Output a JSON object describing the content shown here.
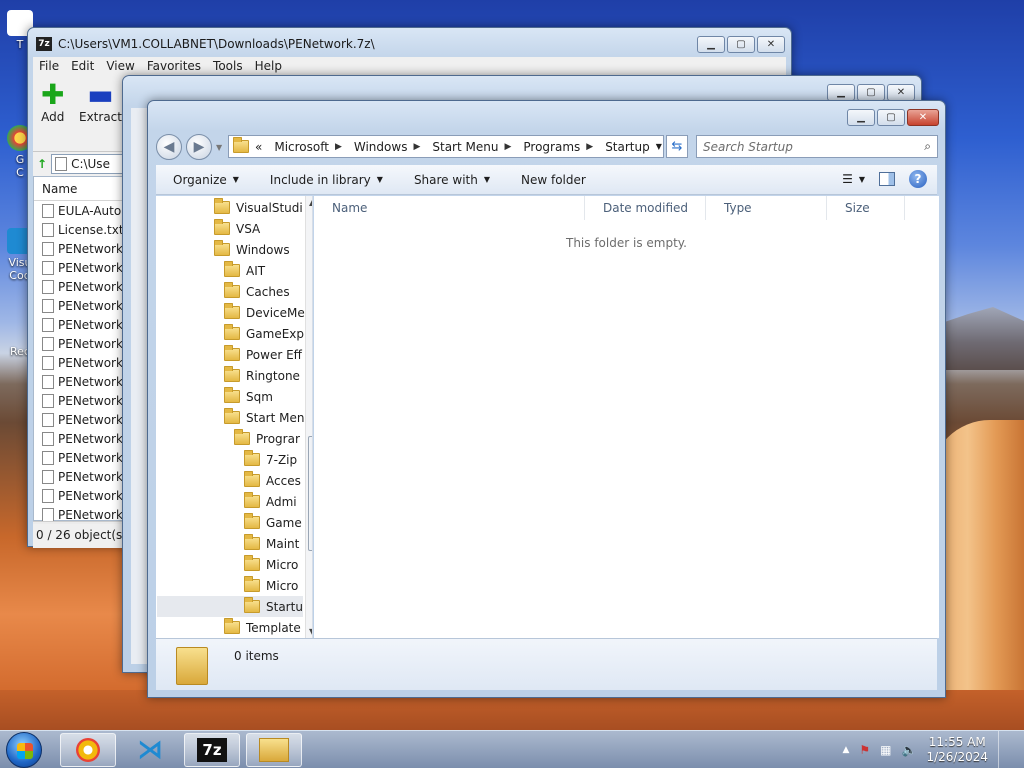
{
  "desktop": {
    "icons": [
      {
        "label": "T",
        "name": "desktop-icon-top"
      },
      {
        "label": "G\nC",
        "name": "desktop-icon-chrome"
      },
      {
        "label": "Visu\nCod",
        "name": "desktop-icon-vscode"
      },
      {
        "label": "Rec",
        "name": "desktop-icon-recycle"
      }
    ]
  },
  "zip": {
    "title": "C:\\Users\\VM1.COLLABNET\\Downloads\\PENetwork.7z\\",
    "menu": [
      "File",
      "Edit",
      "View",
      "Favorites",
      "Tools",
      "Help"
    ],
    "toolbar": {
      "add": "Add",
      "extract": "Extract"
    },
    "path": "C:\\Use",
    "list_header": "Name",
    "files": [
      "EULA-AutoIt",
      "License.txt",
      "PENetwork.e",
      "PENetwork.i",
      "PENetwork_",
      "PENetwork_",
      "PENetwork_",
      "PENetwork_",
      "PENetwork_",
      "PENetwork_f",
      "PENetwork_l",
      "PENetwork_i",
      "PENetwork_j",
      "PENetwork_l",
      "PENetwork_(",
      "PENetwork_p",
      "PENetwork_p"
    ],
    "status": "0 / 26 object(s) s"
  },
  "explorer": {
    "breadcrumb": [
      "Microsoft",
      "Windows",
      "Start Menu",
      "Programs",
      "Startup"
    ],
    "breadcrumb_prefix": "«",
    "search_placeholder": "Search Startup",
    "commands": {
      "organize": "Organize",
      "include": "Include in library",
      "share": "Share with",
      "new_folder": "New folder"
    },
    "tree": [
      {
        "label": "VisualStudi",
        "indent": 0
      },
      {
        "label": "VSA",
        "indent": 0
      },
      {
        "label": "Windows",
        "indent": 0
      },
      {
        "label": "AIT",
        "indent": 1
      },
      {
        "label": "Caches",
        "indent": 1
      },
      {
        "label": "DeviceMe",
        "indent": 1
      },
      {
        "label": "GameExp",
        "indent": 1
      },
      {
        "label": "Power Eff",
        "indent": 1
      },
      {
        "label": "Ringtone",
        "indent": 1
      },
      {
        "label": "Sqm",
        "indent": 1
      },
      {
        "label": "Start Men",
        "indent": 1
      },
      {
        "label": "Prograr",
        "indent": 2
      },
      {
        "label": "7-Zip",
        "indent": 3
      },
      {
        "label": "Acces",
        "indent": 3
      },
      {
        "label": "Admi",
        "indent": 3
      },
      {
        "label": "Game",
        "indent": 3
      },
      {
        "label": "Maint",
        "indent": 3
      },
      {
        "label": "Micro",
        "indent": 3
      },
      {
        "label": "Micro",
        "indent": 3
      },
      {
        "label": "Startu",
        "indent": 3
      },
      {
        "label": "Template",
        "indent": 1
      }
    ],
    "columns": [
      "Name",
      "Date modified",
      "Type",
      "Size"
    ],
    "empty_message": "This folder is empty.",
    "items_count": "0 items"
  },
  "taskbar": {
    "time": "11:55 AM",
    "date": "1/26/2024",
    "apps": [
      "chrome",
      "vscode",
      "7-zip",
      "explorer"
    ]
  }
}
